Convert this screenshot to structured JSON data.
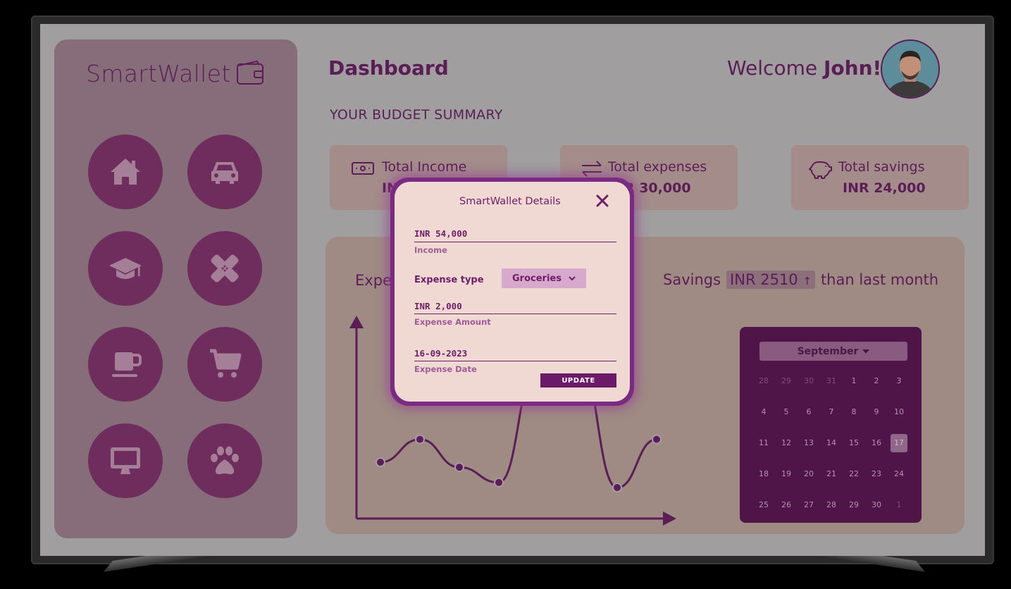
{
  "app": {
    "name": "SmartWallet"
  },
  "header": {
    "title": "Dashboard",
    "welcome_prefix": "Welcome ",
    "user_name": "John!"
  },
  "summary": {
    "heading": "YOUR BUDGET SUMMARY",
    "cards": [
      {
        "label": "Total Income",
        "value": "INR 54,000",
        "icon": "cash-icon"
      },
      {
        "label": "Total expenses",
        "value": "INR 30,000",
        "icon": "transfer-icon"
      },
      {
        "label": "Total savings",
        "value": "INR 24,000",
        "icon": "piggy-bank-icon"
      }
    ]
  },
  "sidebar": {
    "items": [
      "home",
      "car",
      "education",
      "health",
      "coffee",
      "shopping-cart",
      "computer",
      "pets"
    ]
  },
  "panel": {
    "expenses_label": "Expe",
    "savings_prefix": "Savings",
    "savings_amount": "INR 2510",
    "savings_arrow": "↑",
    "savings_suffix": "than last month"
  },
  "chart_data": {
    "type": "line",
    "title": "",
    "xlabel": "",
    "ylabel": "",
    "series": [
      {
        "values": [
          1.0,
          1.9,
          0.8,
          0.2,
          4.9,
          5.2,
          0.0,
          1.9
        ]
      }
    ]
  },
  "calendar": {
    "month": "September",
    "days": [
      "28",
      "29",
      "30",
      "31",
      "1",
      "2",
      "3",
      "4",
      "5",
      "6",
      "7",
      "8",
      "9",
      "10",
      "11",
      "12",
      "13",
      "14",
      "15",
      "16",
      "17",
      "18",
      "19",
      "20",
      "21",
      "22",
      "23",
      "24",
      "25",
      "26",
      "27",
      "28",
      "29",
      "30",
      "1"
    ],
    "selected": "17"
  },
  "modal": {
    "title": "SmartWallet Details",
    "income_value": "INR 54,000",
    "income_label": "Income",
    "expense_type_label": "Expense type",
    "expense_type_value": "Groceries",
    "amount_value": "INR 2,000",
    "amount_label": "Expense Amount",
    "date_value": "16-09-2023",
    "date_label": "Expense Date",
    "update_label": "UPDATE"
  },
  "colors": {
    "accent": "#5a1d55",
    "sidebar": "#876d79",
    "modal": "#efd9d2",
    "calendar": "#4f1448"
  }
}
